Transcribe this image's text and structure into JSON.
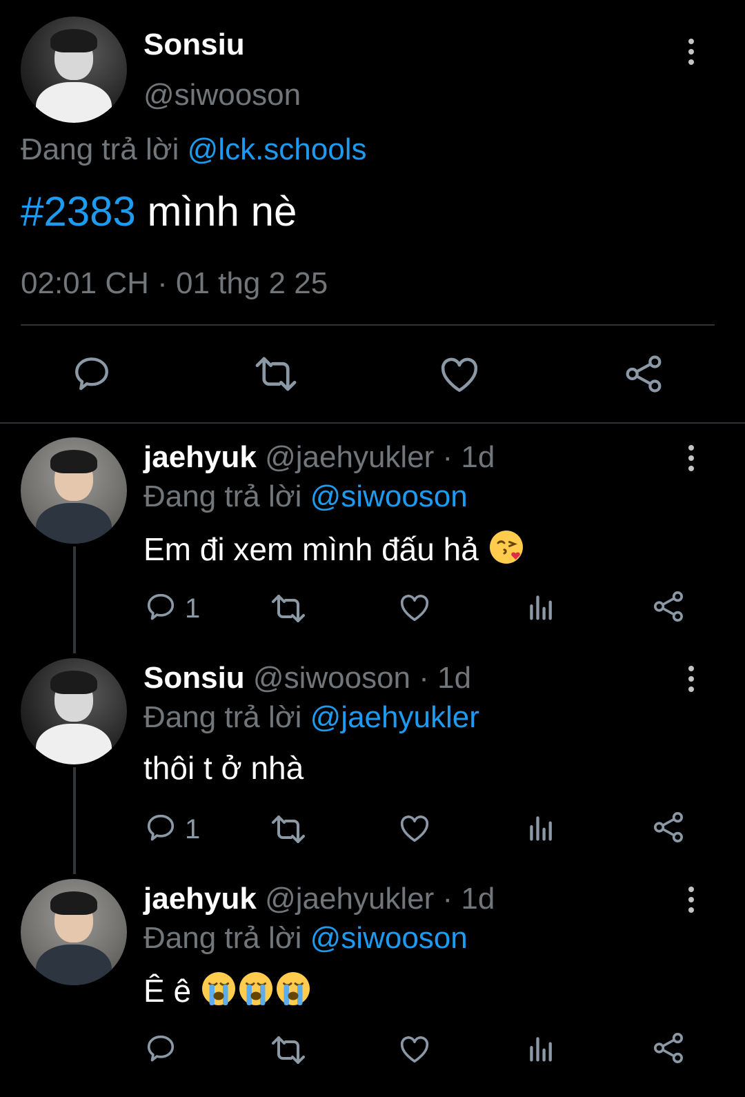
{
  "main_tweet": {
    "display_name": "Sonsiu",
    "handle": "@siwooson",
    "replying_prefix": "Đang trả lời",
    "replying_to": "@lck.schools",
    "hashtag": "#2383",
    "text": " mình nè",
    "timestamp": "02:01 CH · 01 thg 2 25"
  },
  "replies": [
    {
      "display_name": "jaehyuk",
      "meta": "@jaehyukler · 1d",
      "replying_prefix": "Đang trả lời",
      "replying_to": "@siwooson",
      "text": "Em đi xem mình đấu hả",
      "reply_count": "1"
    },
    {
      "display_name": "Sonsiu",
      "meta": "@siwooson · 1d",
      "replying_prefix": "Đang trả lời",
      "replying_to": "@jaehyukler",
      "text": "thôi t ở nhà",
      "reply_count": "1"
    },
    {
      "display_name": "jaehyuk",
      "meta": "@jaehyukler · 1d",
      "replying_prefix": "Đang trả lời",
      "replying_to": "@siwooson",
      "text": "Ê ê",
      "reply_count": ""
    }
  ],
  "icons": {
    "reply": "reply-icon",
    "retweet": "retweet-icon",
    "like": "like-icon",
    "views": "views-icon",
    "share": "share-icon",
    "more": "more-icon"
  },
  "colors": {
    "background": "#000000",
    "text": "#e7e9ea",
    "muted": "#71767b",
    "link": "#1d9bf0"
  }
}
